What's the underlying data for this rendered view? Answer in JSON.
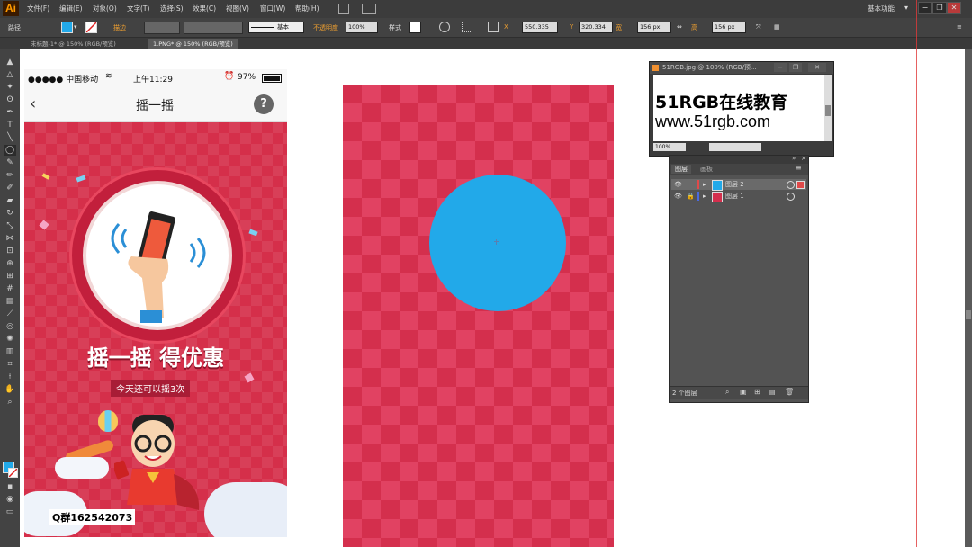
{
  "app": {
    "logo": "Ai",
    "workspace": "基本功能",
    "menu": [
      "文件(F)",
      "编辑(E)",
      "对象(O)",
      "文字(T)",
      "选择(S)",
      "效果(C)",
      "视图(V)",
      "窗口(W)",
      "帮助(H)"
    ]
  },
  "control_bar": {
    "selection_label": "路径",
    "stroke_label": "描边",
    "stroke_profile": "基本",
    "opacity_label": "不透明度",
    "opacity_value": "100%",
    "style_label": "样式",
    "x_label": "X",
    "x_value": "550.335",
    "y_label": "Y",
    "y_value": "320.334",
    "w_label": "宽",
    "w_value": "156 px",
    "h_label": "高",
    "h_value": "156 px",
    "fill_color": "#22a9e9"
  },
  "tabs": [
    {
      "label": "未标题-1* @ 150% (RGB/预览)"
    },
    {
      "label": "1.PNG* @ 150% (RGB/预览)"
    }
  ],
  "phone": {
    "carrier": "●●●●● 中国移动",
    "time": "上午11:29",
    "battery": "97%",
    "title": "摇一摇",
    "help_icon": "?",
    "headline": "摇一摇 得优惠",
    "sub": "今天还可以摇3次",
    "qq": "Q群162542073"
  },
  "image_window": {
    "title": "51RGB.jpg @ 100% (RGB/预...",
    "line1": "51RGB在线教育",
    "line2": "www.51rgb.com",
    "zoom": "100%"
  },
  "layers_panel": {
    "tab_layers": "图层",
    "tab_artboards": "画板",
    "layers": [
      {
        "name": "图层 2",
        "color": "#e04a4a"
      },
      {
        "name": "图层 1",
        "color": "#4a6ae0"
      }
    ],
    "count": "2 个图层"
  },
  "colors": {
    "artboard_red": "#d42f4d",
    "circle_blue": "#22a9e9"
  }
}
